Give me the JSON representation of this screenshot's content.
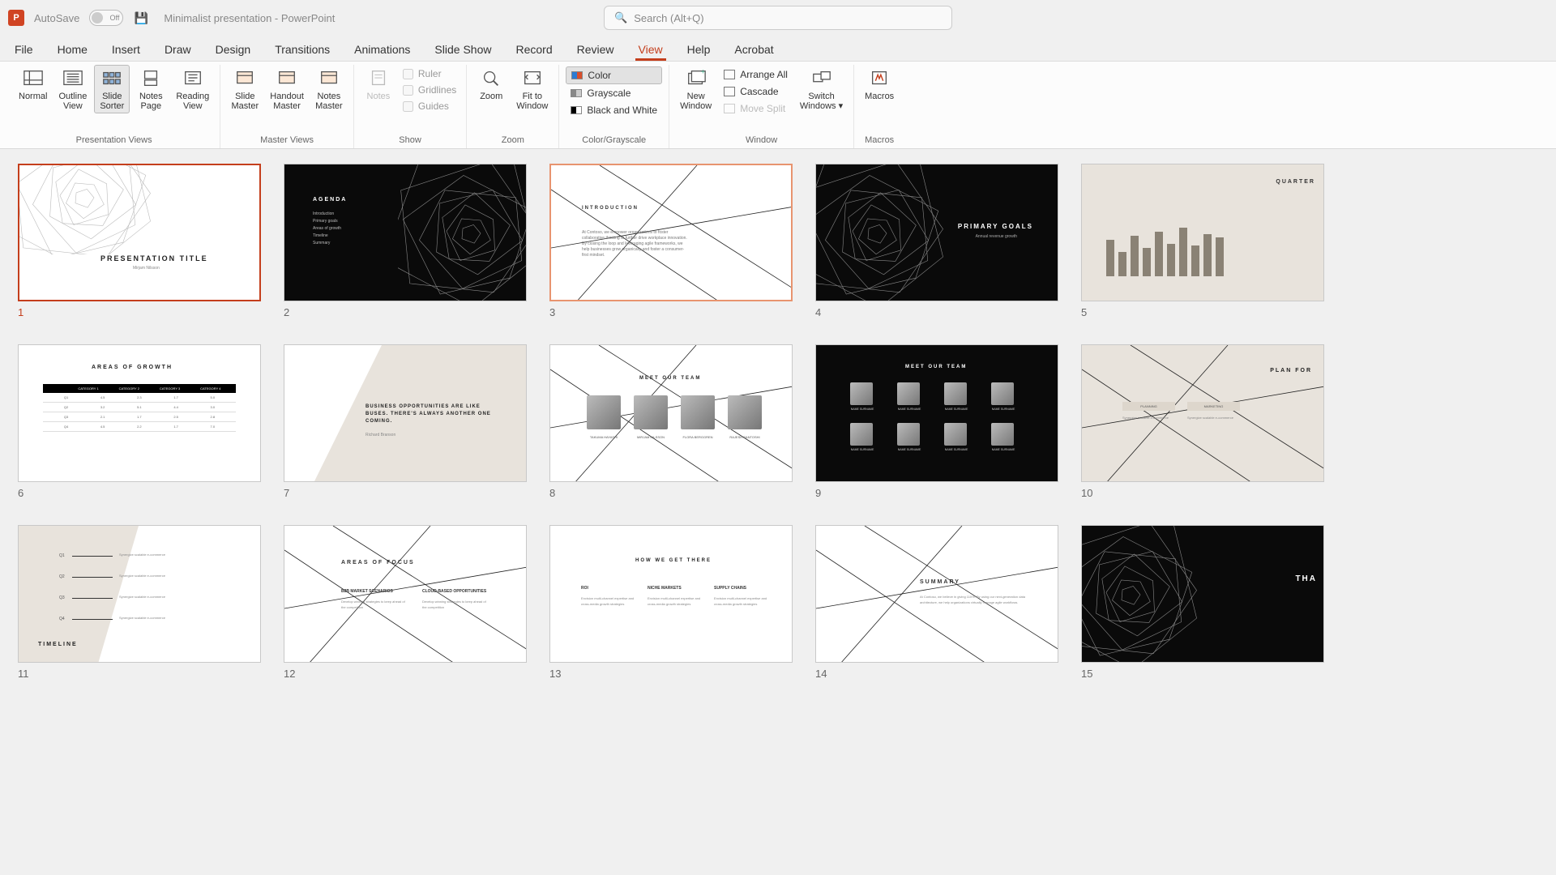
{
  "titlebar": {
    "autosave_label": "AutoSave",
    "autosave_state": "Off",
    "doc_title": "Minimalist presentation - PowerPoint"
  },
  "search": {
    "placeholder": "Search (Alt+Q)"
  },
  "tabs": [
    "File",
    "Home",
    "Insert",
    "Draw",
    "Design",
    "Transitions",
    "Animations",
    "Slide Show",
    "Record",
    "Review",
    "View",
    "Help",
    "Acrobat"
  ],
  "active_tab": "View",
  "ribbon": {
    "groups": [
      {
        "label": "Presentation Views",
        "buttons": [
          {
            "label": "Normal"
          },
          {
            "label": "Outline\nView"
          },
          {
            "label": "Slide\nSorter",
            "selected": true
          },
          {
            "label": "Notes\nPage"
          },
          {
            "label": "Reading\nView"
          }
        ]
      },
      {
        "label": "Master Views",
        "buttons": [
          {
            "label": "Slide\nMaster"
          },
          {
            "label": "Handout\nMaster"
          },
          {
            "label": "Notes\nMaster"
          }
        ]
      },
      {
        "label": "Show",
        "checks": [
          "Ruler",
          "Gridlines",
          "Guides"
        ],
        "buttons": [
          {
            "label": "Notes",
            "disabled": true
          }
        ]
      },
      {
        "label": "Zoom",
        "buttons": [
          {
            "label": "Zoom"
          },
          {
            "label": "Fit to\nWindow"
          }
        ]
      },
      {
        "label": "Color/Grayscale",
        "items": [
          {
            "label": "Color",
            "selected": true,
            "swatch": "linear-gradient(90deg,#2b7cd3 50%,#d94f2b 50%)"
          },
          {
            "label": "Grayscale",
            "swatch": "linear-gradient(90deg,#888 50%,#ccc 50%)"
          },
          {
            "label": "Black and White",
            "swatch": "linear-gradient(90deg,#000 50%,#fff 50%)"
          }
        ]
      },
      {
        "label": "Window",
        "buttons": [
          {
            "label": "New\nWindow"
          }
        ],
        "items": [
          {
            "label": "Arrange All"
          },
          {
            "label": "Cascade"
          },
          {
            "label": "Move Split",
            "disabled": true
          }
        ],
        "buttons2": [
          {
            "label": "Switch\nWindows ▾"
          }
        ]
      },
      {
        "label": "Macros",
        "buttons": [
          {
            "label": "Macros"
          }
        ]
      }
    ]
  },
  "slides": [
    {
      "n": 1,
      "title": "PRESENTATION TITLE",
      "sub": "Mirjam Nilsson",
      "bg": "white",
      "sel": "red"
    },
    {
      "n": 2,
      "title": "AGENDA",
      "bg": "dark",
      "list": [
        "Introduction",
        "Primary goals",
        "Areas of growth",
        "Timeline",
        "Summary"
      ]
    },
    {
      "n": 3,
      "title": "INTRODUCTION",
      "bg": "white",
      "sel": "orange",
      "body": "At Contoso, we empower organizations to foster collaborative thinking to further drive workplace innovation. By closing the loop and leveraging agile frameworks, we help businesses grow organically and foster a consumer-first mindset."
    },
    {
      "n": 4,
      "title": "PRIMARY GOALS",
      "sub": "Annual revenue growth",
      "bg": "dark"
    },
    {
      "n": 5,
      "title": "QUARTER",
      "bg": "beige",
      "chart": true
    },
    {
      "n": 6,
      "title": "AREAS OF GROWTH",
      "bg": "white",
      "table": true
    },
    {
      "n": 7,
      "title": "BUSINESS OPPORTUNITIES ARE LIKE BUSES. THERE'S ALWAYS ANOTHER ONE COMING.",
      "sub": "Richard Branson",
      "bg": "beige"
    },
    {
      "n": 8,
      "title": "MEET OUR TEAM",
      "bg": "white",
      "team4": [
        "TAKUMA HAYASHI",
        "MIRJAM NILSSON",
        "FLORA BERGGREN",
        "RAJESH SANTOSHI"
      ]
    },
    {
      "n": 9,
      "title": "MEET OUR TEAM",
      "bg": "dark",
      "team8": true
    },
    {
      "n": 10,
      "title": "PLAN FOR",
      "bg": "beige",
      "cols": [
        "PLANNING",
        "MARKETING"
      ]
    },
    {
      "n": 11,
      "title": "TIMELINE",
      "bg": "beige",
      "timeline": [
        "Q1",
        "Q2",
        "Q3",
        "Q4"
      ]
    },
    {
      "n": 12,
      "title": "AREAS OF FOCUS",
      "bg": "white",
      "focus": [
        "B2B MARKET SCENARIOS",
        "CLOUD-BASED OPPORTUNITIES"
      ]
    },
    {
      "n": 13,
      "title": "HOW WE GET THERE",
      "bg": "white",
      "cols3": [
        "ROI",
        "NICHE MARKETS",
        "SUPPLY CHAINS"
      ]
    },
    {
      "n": 14,
      "title": "SUMMARY",
      "bg": "white",
      "body": "At Contoso, we believe in giving 110%. By using our next-generation data architecture, we help organizations virtually manage agile workflows."
    },
    {
      "n": 15,
      "title": "THA",
      "bg": "dark"
    }
  ],
  "table6": {
    "headers": [
      "CATEGORY 1",
      "CATEGORY 2",
      "CATEGORY 3",
      "CATEGORY 4"
    ],
    "rows": [
      [
        "Q1",
        "4.5",
        "2.3",
        "1.7",
        "5.0"
      ],
      [
        "Q2",
        "3.2",
        "5.1",
        "4.4",
        "3.0"
      ],
      [
        "Q3",
        "2.1",
        "1.7",
        "2.5",
        "2.8"
      ],
      [
        "Q4",
        "4.5",
        "2.2",
        "1.7",
        "7.0"
      ]
    ]
  }
}
